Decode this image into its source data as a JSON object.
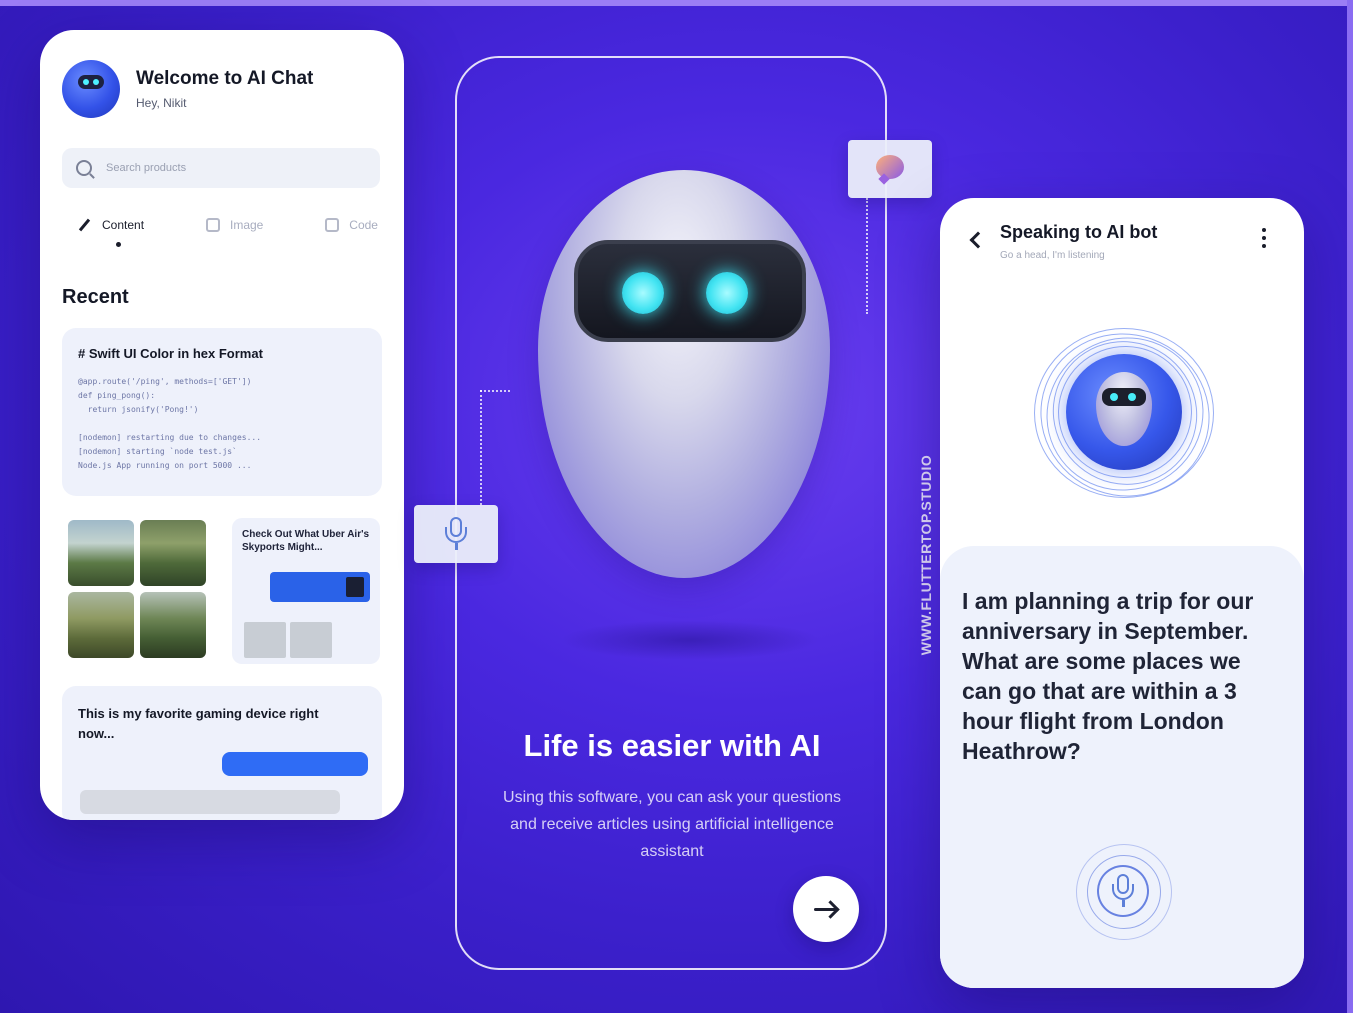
{
  "left_phone": {
    "title": "Welcome to AI Chat",
    "subtitle": "Hey, Nikit",
    "search_placeholder": "Search products",
    "tabs": [
      {
        "label": "Content",
        "icon": "pen-icon",
        "active": true
      },
      {
        "label": "Image",
        "icon": "image-icon",
        "active": false
      },
      {
        "label": "Code",
        "icon": "code-icon",
        "active": false
      }
    ],
    "recent_heading": "Recent",
    "code_card": {
      "title": "# Swift UI Color in hex Format",
      "lines": "@app.route('/ping', methods=['GET'])\ndef ping_pong():\n  return jsonify('Pong!')\n\n[nodemon] restarting due to changes...\n[nodemon] starting `node test.js`\nNode.js App running on port 5000 ..."
    },
    "article_card": {
      "title": "Check Out What Uber Air's Skyports Might..."
    },
    "post_card": {
      "title": "This is my favorite gaming device right now..."
    }
  },
  "center_phone": {
    "title": "Life is easier with AI",
    "description": "Using this software, you can ask your questions and receive articles using artificial intelligence assistant",
    "next_icon": "arrow-right-icon"
  },
  "watermark": "WWW.FLUTTERTOP.STUDIO",
  "right_phone": {
    "title": "Speaking to AI bot",
    "subtitle": "Go a head, I'm listening",
    "prompt": "I am planning a trip for our anniversary in September. What are some places we can go that are within a 3 hour flight from London Heathrow?",
    "mic_icon": "mic-icon"
  },
  "colors": {
    "background": "#4a28e0",
    "accent_blue": "#2f6cf5",
    "eye_cyan": "#43e4f2"
  }
}
